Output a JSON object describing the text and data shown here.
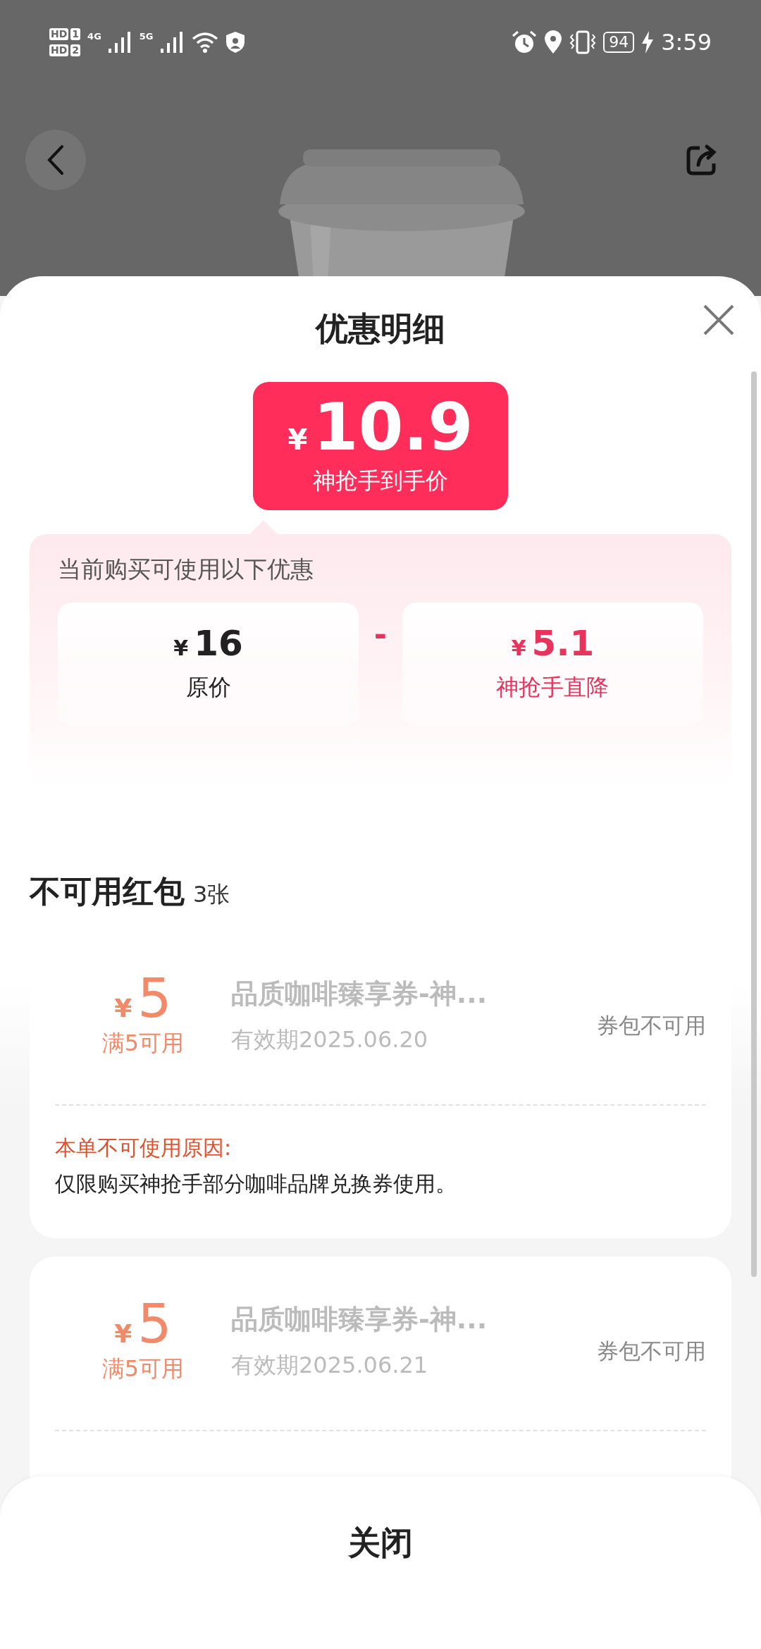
{
  "status_bar": {
    "sims": [
      {
        "hd": "HD",
        "slot": "1"
      },
      {
        "hd": "HD",
        "slot": "2"
      }
    ],
    "networks": [
      "4G",
      "5G"
    ],
    "battery": "94",
    "time": "3:59"
  },
  "sheet": {
    "title": "优惠明细",
    "final_price": {
      "currency": "¥",
      "amount": "10.9",
      "label": "神抢手到手价"
    },
    "breakdown": {
      "caption": "当前购买可使用以下优惠",
      "operator": "-",
      "items": [
        {
          "currency": "¥",
          "amount": "16",
          "label": "原价",
          "kind": "base"
        },
        {
          "currency": "¥",
          "amount": "5.1",
          "label": "神抢手直降",
          "kind": "discount"
        }
      ]
    },
    "unavailable": {
      "title": "不可用红包",
      "count": "3张",
      "coupons": [
        {
          "currency": "¥",
          "amount": "5",
          "condition": "满5可用",
          "name": "品质咖啡臻享券-神...",
          "validity": "有效期2025.06.20",
          "status": "券包不可用",
          "reason_label": "本单不可使用原因:",
          "reason": "仅限购买神抢手部分咖啡品牌兑换券使用。"
        },
        {
          "currency": "¥",
          "amount": "5",
          "condition": "满5可用",
          "name": "品质咖啡臻享券-神...",
          "validity": "有效期2025.06.21",
          "status": "券包不可用"
        }
      ]
    }
  },
  "footer": {
    "button": "关闭"
  }
}
